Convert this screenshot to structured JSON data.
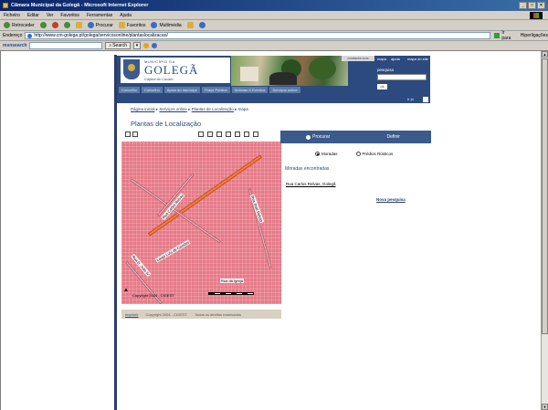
{
  "browser": {
    "title": "Câmara Municipal da Golegã - Microsoft Internet Explorer",
    "menu": [
      "Ficheiro",
      "Editar",
      "Ver",
      "Favoritos",
      "Ferramentas",
      "Ajuda"
    ],
    "toolbar": {
      "back": "Retroceder",
      "search": "Procurar",
      "favorites": "Favoritos",
      "media": "Multimédia"
    },
    "address_label": "Endereço",
    "address_url": "http://www.cm-golega.pt/golega/servicosonline/plantaslocalizacao/",
    "go_label": "Ir para",
    "links_label": "Hiperligações",
    "search_brand": "msnsearch",
    "search_button": "Search",
    "icons": [
      "back-icon",
      "forward-icon",
      "stop-icon",
      "refresh-icon",
      "home-icon",
      "search-icon",
      "favorites-icon",
      "media-icon",
      "mail-icon",
      "print-icon"
    ]
  },
  "site": {
    "municipality_line": "MUNICÍPIO DA",
    "town": "GOLEGÃ",
    "tagline": "Capital do Cavalo",
    "contact": "contacte-nos",
    "top_tabs": [
      "mapa",
      "ajuda",
      "mapa do site"
    ],
    "search_label": "pesquisa",
    "search_ok": "ok",
    "nav": [
      "Concelho",
      "Conselho",
      "Apoio ao munícipe",
      "Praça Pública",
      "Notícias & Eventos",
      "Serviços online"
    ],
    "strip_label": "Ir p/"
  },
  "breadcrumb": {
    "home": "Página inicial",
    "services": "Serviços online",
    "plans": "Plantas de Localização",
    "current": "mapa"
  },
  "page_title": "Plantas de Localização",
  "map": {
    "streets": [
      "Rua Carlos Relvas",
      "Rua José Relvas",
      "Largo Luís de Camões",
      "Rua D. João IV",
      "Rua da Igreja"
    ],
    "copyright": "Copyright 2004 - CIGEST",
    "scale_label": "0 100 200m",
    "footer_link": "Imprimir",
    "footer_copy": "Copyright 2004 - CIGEST",
    "footer_right": "Todos os direitos reservados"
  },
  "panel": {
    "tab_search": "Procurar",
    "tab_other": "Definir",
    "radio_moradas": "Moradas",
    "radio_predios": "Prédios Rústicos",
    "found_label": "Moradas encontradas",
    "result": "Rua Carlos Relvas, Golegã",
    "new_search": "Nova pesquisa"
  }
}
